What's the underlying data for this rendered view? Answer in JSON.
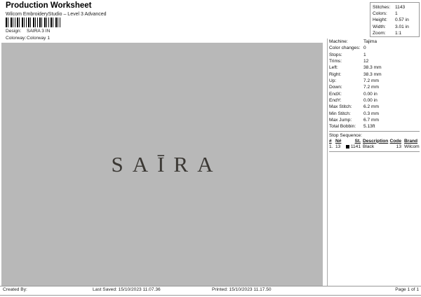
{
  "header": {
    "title": "Production Worksheet",
    "subtitle": "Wilcom EmbroideryStudio – Level 3 Advanced",
    "design_label": "Design:",
    "design_value": "SAIRA 3 IN",
    "colorway_label": "Colorway:",
    "colorway_value": "Colorway 1"
  },
  "summary": {
    "rows": [
      {
        "label": "Stitches:",
        "value": "1143"
      },
      {
        "label": "Colors:",
        "value": "1"
      },
      {
        "label": "Height:",
        "value": "0.57 in"
      },
      {
        "label": "Width:",
        "value": "3.01 in"
      },
      {
        "label": "Zoom:",
        "value": "1:1"
      }
    ]
  },
  "canvas": {
    "design_text": "SAĪRA"
  },
  "machine": {
    "rows": [
      {
        "label": "Machine:",
        "value": "Tajima"
      },
      {
        "label": "Color changes:",
        "value": "0"
      },
      {
        "label": "Stops:",
        "value": "1"
      },
      {
        "label": "Trims:",
        "value": "12"
      },
      {
        "label": "Left:",
        "value": "38.3 mm"
      },
      {
        "label": "Right:",
        "value": "38.3 mm"
      },
      {
        "label": "Up:",
        "value": "7.2 mm"
      },
      {
        "label": "Down:",
        "value": "7.2 mm"
      },
      {
        "label": "EndX:",
        "value": "0.00 in"
      },
      {
        "label": "EndY:",
        "value": "0.00 in"
      },
      {
        "label": "Max Stitch:",
        "value": "6.2 mm"
      },
      {
        "label": "Min Stitch:",
        "value": "0.3 mm"
      },
      {
        "label": "Max Jump:",
        "value": "6.7 mm"
      },
      {
        "label": "Total Bobbin:",
        "value": "5.13ft"
      }
    ]
  },
  "stop_sequence": {
    "title": "Stop Sequence:",
    "columns": [
      "#",
      "N#",
      "St.",
      "Description",
      "Code",
      "Brand"
    ],
    "rows": [
      {
        "num": "1.",
        "n": "13",
        "st": "1141",
        "description": "Black",
        "code": "13",
        "brand": "Wilcom",
        "swatch_color": "#000000"
      }
    ]
  },
  "footer": {
    "created_by": "Created By:",
    "last_saved": "Last Saved: 15/10/2023 11.07.36",
    "printed": "Printed: 15/10/2023 11.17.50",
    "page": "Page 1 of 1"
  },
  "colors": {
    "canvas_background": "#b8b8b8",
    "design_text_color": "#3b3834",
    "rule_color": "#999999"
  }
}
